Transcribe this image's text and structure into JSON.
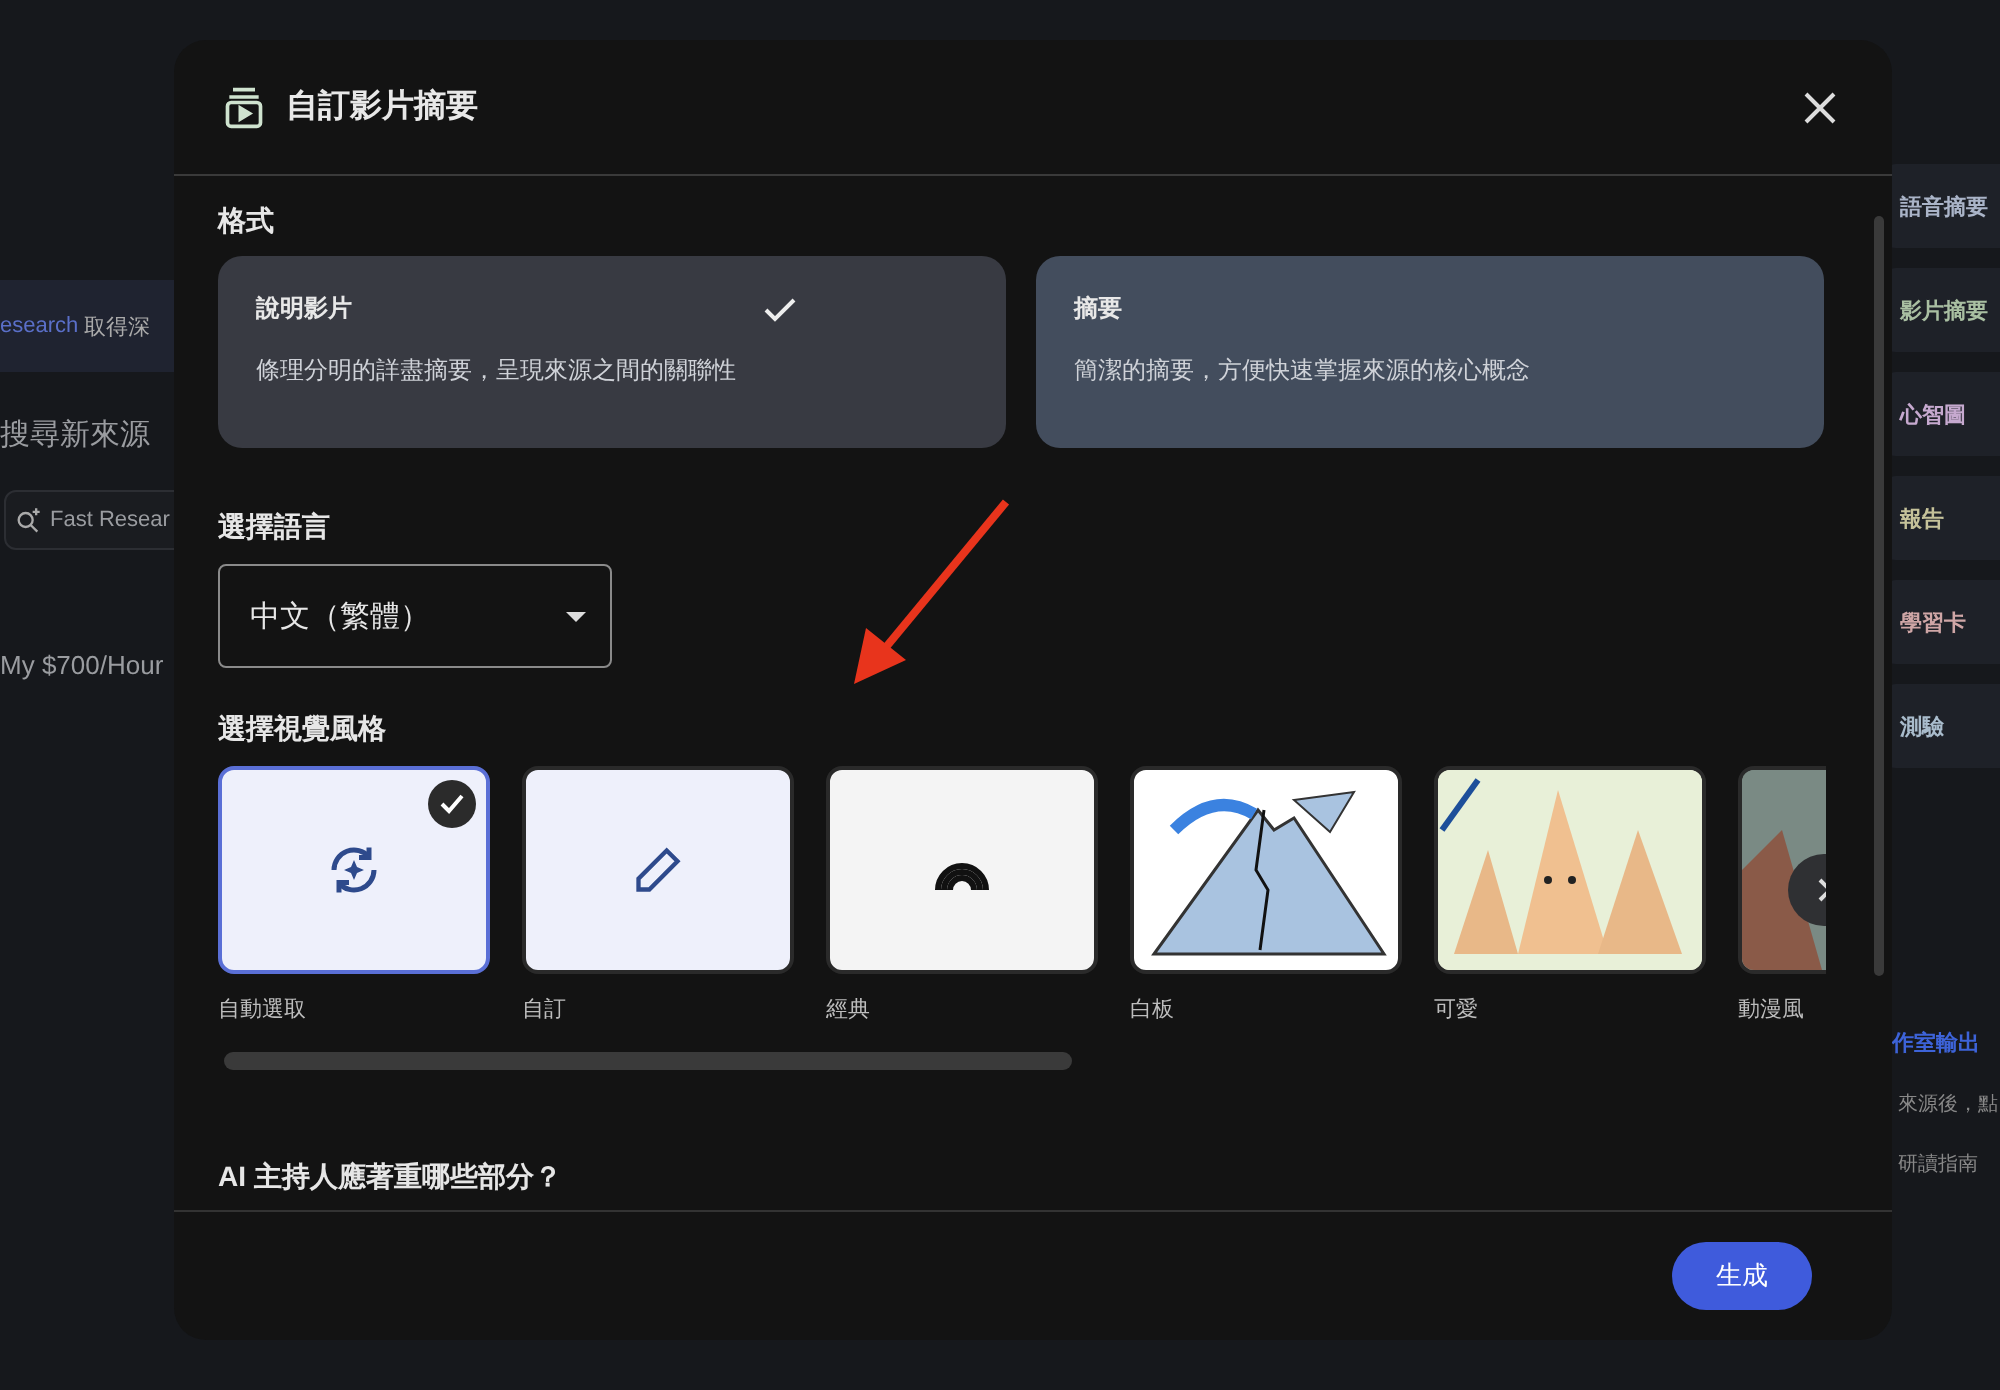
{
  "background": {
    "left_panel": {
      "research_link": "esearch",
      "research_text": "取得深",
      "search_heading": "搜尋新來源",
      "fast_research": "Fast Resear",
      "source_title": "My $700/Hour"
    },
    "studio_items": [
      {
        "label": "語音摘要",
        "color": "#aab4c8"
      },
      {
        "label": "影片摘要",
        "color": "#a9bfa2"
      },
      {
        "label": "心智圖",
        "color": "#c6a9cf"
      },
      {
        "label": "報告",
        "color": "#c5c29a"
      },
      {
        "label": "學習卡",
        "color": "#cfa6a6"
      },
      {
        "label": "測驗",
        "color": "#a9bccc"
      }
    ],
    "studio_note_title": "作室輸出",
    "studio_note_lines": [
      "來源後，點",
      "研讀指南"
    ]
  },
  "dialog": {
    "title": "自訂影片摘要",
    "format_label": "格式",
    "formats": [
      {
        "title": "說明影片",
        "description": "條理分明的詳盡摘要，呈現來源之間的關聯性",
        "selected": true
      },
      {
        "title": "摘要",
        "description": "簡潔的摘要，方便快速掌握來源的核心概念",
        "selected": false
      }
    ],
    "language_label": "選擇語言",
    "language": "中文（繁體）",
    "style_label": "選擇視覺風格",
    "styles": [
      {
        "kind": "auto",
        "label": "自動選取",
        "selected": true
      },
      {
        "kind": "custom",
        "label": "自訂",
        "selected": false
      },
      {
        "kind": "classic",
        "label": "經典",
        "selected": false
      },
      {
        "kind": "whiteboard",
        "label": "白板",
        "selected": false
      },
      {
        "kind": "cute",
        "label": "可愛",
        "selected": false
      },
      {
        "kind": "anime",
        "label": "動漫風",
        "selected": false
      }
    ],
    "focus_question": "AI 主持人應著重哪些部分？",
    "generate_button": "生成"
  }
}
